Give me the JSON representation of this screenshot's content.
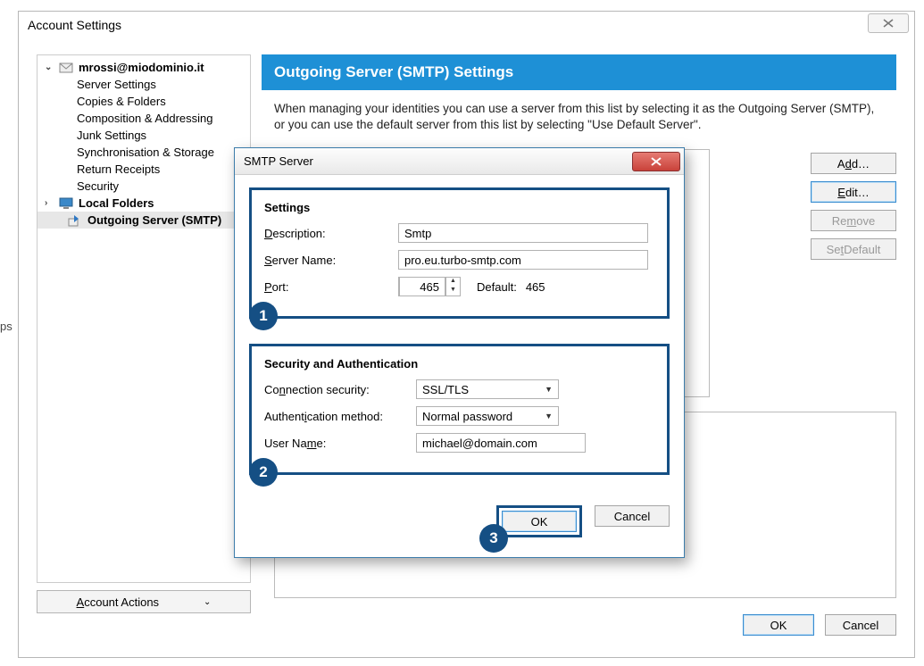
{
  "parent": {
    "title": "Account Settings",
    "tree": {
      "expand1": "⌄",
      "acct_name": "mrossi@miodominio.it",
      "items": [
        "Server Settings",
        "Copies & Folders",
        "Composition & Addressing",
        "Junk Settings",
        "Synchronisation & Storage",
        "Return Receipts",
        "Security"
      ],
      "expand2": "›",
      "local_folders": "Local Folders",
      "outgoing": "Outgoing Server (SMTP)"
    },
    "account_actions_label": "Account Actions",
    "header": "Outgoing Server (SMTP) Settings",
    "info_text": "When managing your identities you can use a server from this list by selecting it as the Outgoing Server (SMTP), or you can use the default server from this list by selecting \"Use Default Server\".",
    "side_buttons": {
      "add": "Add…",
      "edit": "Edit…",
      "remove": "Remove",
      "set_default": "Set Default"
    },
    "footer": {
      "ok": "OK",
      "cancel": "Cancel"
    }
  },
  "modal": {
    "title": "SMTP Server",
    "group1_title": "Settings",
    "desc_label": "Description:",
    "desc_value": "Smtp",
    "server_label": "Server Name:",
    "server_value": "pro.eu.turbo-smtp.com",
    "port_label": "Port:",
    "port_value": "465",
    "default_label": "Default:",
    "default_value": "465",
    "group2_title": "Security and Authentication",
    "connsec_label": "Connection security:",
    "connsec_value": "SSL/TLS",
    "auth_label": "Authentication method:",
    "auth_value": "Normal password",
    "user_label": "User Name:",
    "user_value": "michael@domain.com",
    "badges": {
      "s1": "1",
      "s2": "2",
      "s3": "3"
    },
    "buttons": {
      "ok": "OK",
      "cancel": "Cancel"
    }
  },
  "misc": {
    "left_frag": "ps"
  }
}
